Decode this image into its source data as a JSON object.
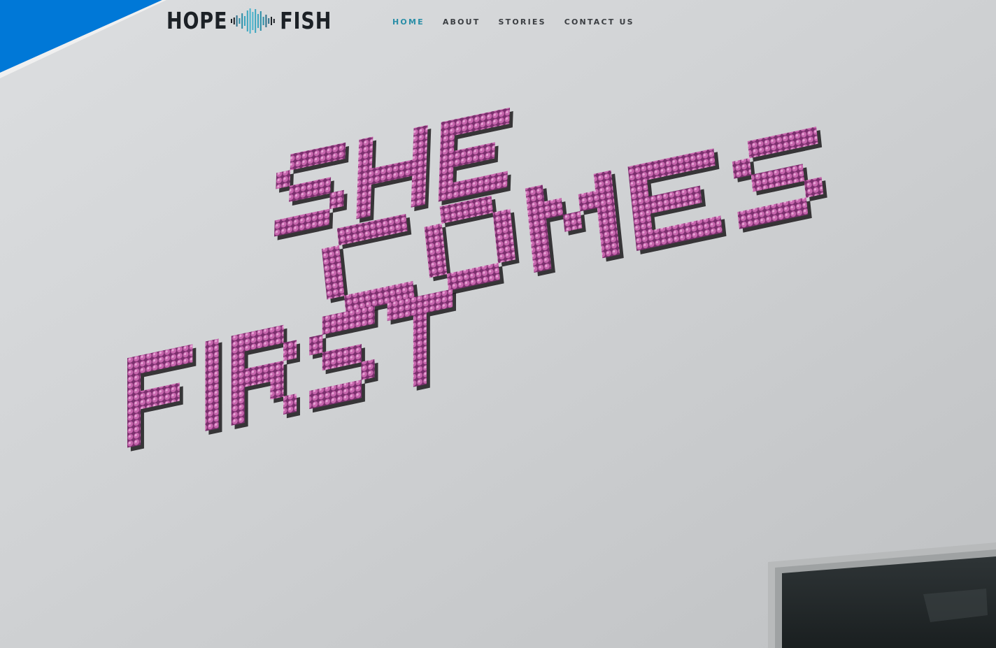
{
  "brand": {
    "left_word": "HOPE",
    "right_word": "FISH",
    "accent_color": "#2a8ea7",
    "corner_color": "#0078d7"
  },
  "nav": {
    "items": [
      {
        "label": "HOME",
        "active": true
      },
      {
        "label": "ABOUT",
        "active": false
      },
      {
        "label": "STORIES",
        "active": false
      },
      {
        "label": "CONTACT US",
        "active": false
      }
    ]
  },
  "hero": {
    "lines": [
      "SHE",
      "COMES",
      "FIRST"
    ],
    "letter_color": "#c25aa8"
  }
}
